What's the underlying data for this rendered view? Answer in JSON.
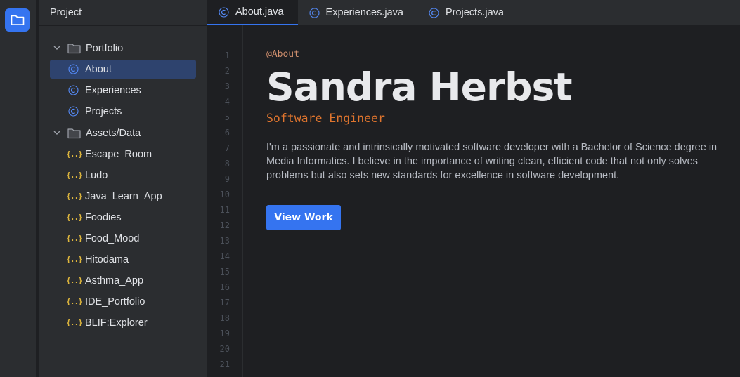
{
  "sidebar": {
    "icon": "folder-icon"
  },
  "project_panel": {
    "title": "Project",
    "tree": [
      {
        "label": "Portfolio",
        "type": "folder",
        "icon": "folder-icon",
        "expanded": true
      },
      {
        "label": "About",
        "type": "class",
        "icon": "java-class-icon",
        "selected": true
      },
      {
        "label": "Experiences",
        "type": "class",
        "icon": "java-class-icon"
      },
      {
        "label": "Projects",
        "type": "class",
        "icon": "java-class-icon"
      },
      {
        "label": "Assets/Data",
        "type": "folder",
        "icon": "folder-icon",
        "expanded": true
      },
      {
        "label": "Escape_Room",
        "type": "json",
        "icon": "json-icon"
      },
      {
        "label": "Ludo",
        "type": "json",
        "icon": "json-icon"
      },
      {
        "label": "Java_Learn_App",
        "type": "json",
        "icon": "json-icon"
      },
      {
        "label": "Foodies",
        "type": "json",
        "icon": "json-icon"
      },
      {
        "label": "Food_Mood",
        "type": "json",
        "icon": "json-icon"
      },
      {
        "label": "Hitodama",
        "type": "json",
        "icon": "json-icon"
      },
      {
        "label": "Asthma_App",
        "type": "json",
        "icon": "json-icon"
      },
      {
        "label": "IDE_Portfolio",
        "type": "json",
        "icon": "json-icon"
      },
      {
        "label": "BLIF:Explorer",
        "type": "json",
        "icon": "json-icon"
      }
    ]
  },
  "tabs": [
    {
      "label": "About.java",
      "active": true
    },
    {
      "label": "Experiences.java",
      "active": false
    },
    {
      "label": "Projects.java",
      "active": false
    }
  ],
  "editor": {
    "line_numbers": [
      "1",
      "2",
      "3",
      "4",
      "5",
      "6",
      "7",
      "8",
      "9",
      "10",
      "11",
      "12",
      "13",
      "14",
      "15",
      "16",
      "17",
      "18",
      "19",
      "20",
      "21"
    ],
    "annotation": "@About",
    "name": "Sandra Herbst",
    "role": "Software Engineer",
    "bio": "I'm a passionate and intrinsically motivated software developer with a Bachelor of Science degree in Media Informatics. I believe in the importance of writing clean, efficient code that not only solves problems but also sets new standards for excellence in software development.",
    "cta_label": "View Work"
  },
  "colors": {
    "accent": "#3574f0",
    "annotation": "#cf8e6d",
    "role": "#e0752e",
    "json_icon": "#e2b93d",
    "class_icon": "#548af7"
  }
}
